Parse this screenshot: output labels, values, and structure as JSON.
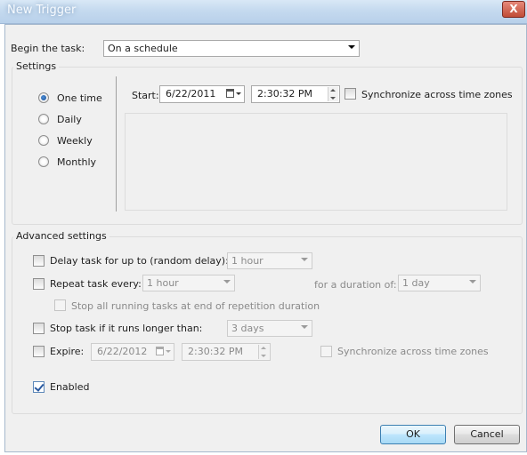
{
  "window": {
    "title": "New Trigger",
    "close_glyph": "X"
  },
  "begin": {
    "label": "Begin the task:",
    "value": "On a schedule"
  },
  "settings": {
    "group_label": "Settings",
    "radios": [
      {
        "label": "One time",
        "selected": true
      },
      {
        "label": "Daily",
        "selected": false
      },
      {
        "label": "Weekly",
        "selected": false
      },
      {
        "label": "Monthly",
        "selected": false
      }
    ],
    "start_label": "Start:",
    "start_date": "6/22/2011",
    "start_time": "2:30:32 PM",
    "sync_label": "Synchronize across time zones"
  },
  "advanced": {
    "group_label": "Advanced settings",
    "delay_label": "Delay task for up to (random delay):",
    "delay_value": "1 hour",
    "repeat_label": "Repeat task every:",
    "repeat_value": "1 hour",
    "duration_label": "for a duration of:",
    "duration_value": "1 day",
    "stop_all_label": "Stop all running tasks at end of repetition duration",
    "stop_longer_label": "Stop task if it runs longer than:",
    "stop_longer_value": "3 days",
    "expire_label": "Expire:",
    "expire_date": "6/22/2012",
    "expire_time": "2:30:32 PM",
    "expire_sync_label": "Synchronize across time zones",
    "enabled_label": "Enabled",
    "enabled_checked": true
  },
  "buttons": {
    "ok": "OK",
    "cancel": "Cancel"
  },
  "colors": {
    "titlebar": "#c5daef",
    "dialog_bg": "#f0f0f0",
    "close_button": "#c04c37",
    "default_button": "#bee6fd"
  }
}
